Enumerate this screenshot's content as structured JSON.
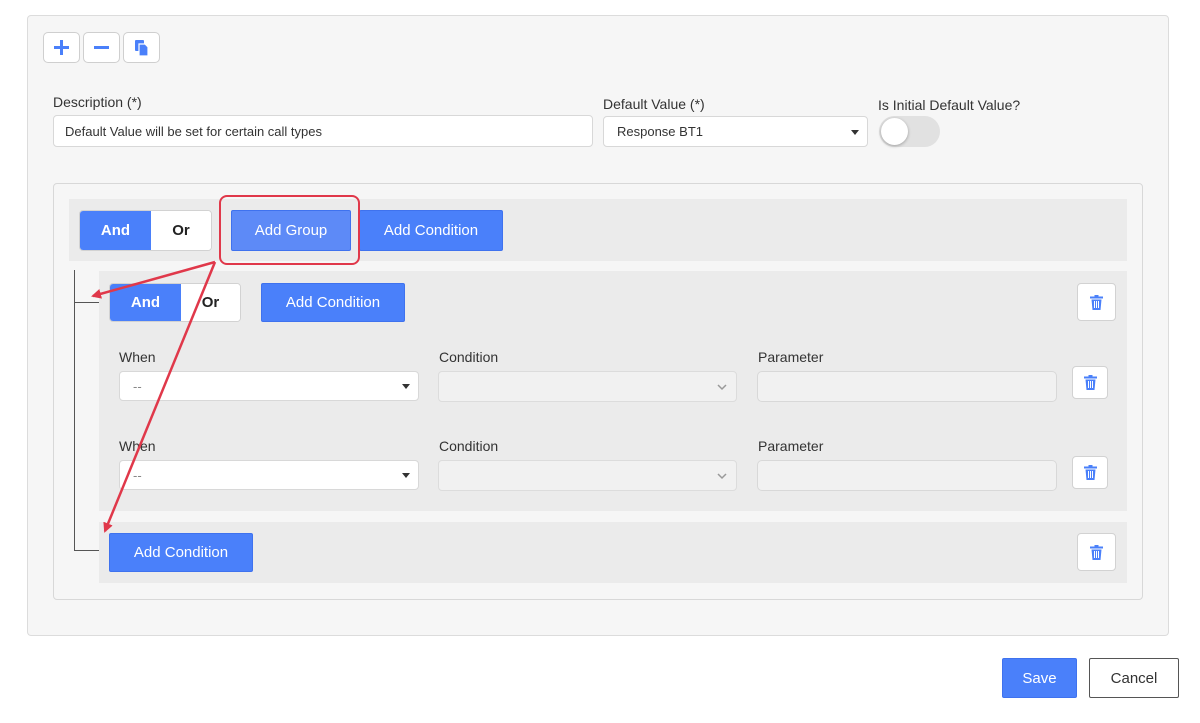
{
  "toolbar": {
    "add_icon": "plus-icon",
    "remove_icon": "minus-icon",
    "copy_icon": "copy-icon"
  },
  "form": {
    "description_label": "Description (*)",
    "description_value": "Default Value will be set for certain call types",
    "default_value_label": "Default Value (*)",
    "default_value_selected": "Response BT1",
    "initial_default_label": "Is Initial Default Value?",
    "initial_default_on": false
  },
  "query_builder": {
    "root": {
      "and_label": "And",
      "or_label": "Or",
      "add_group_label": "Add Group",
      "add_condition_label": "Add Condition"
    },
    "group": {
      "and_label": "And",
      "or_label": "Or",
      "add_condition_label": "Add Condition",
      "rules": [
        {
          "when_label": "When",
          "when_value": "--",
          "condition_label": "Condition",
          "parameter_label": "Parameter"
        },
        {
          "when_label": "When",
          "when_value": "--",
          "condition_label": "Condition",
          "parameter_label": "Parameter"
        }
      ]
    },
    "footer_add_condition_label": "Add Condition"
  },
  "actions": {
    "save_label": "Save",
    "cancel_label": "Cancel"
  },
  "colors": {
    "primary": "#4a80fa",
    "annotation": "#e0384a"
  }
}
